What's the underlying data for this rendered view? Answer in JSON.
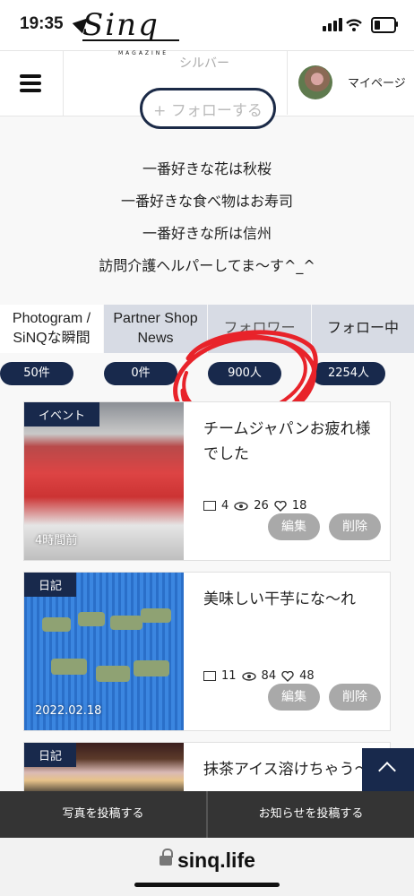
{
  "status_bar": {
    "time": "19:35"
  },
  "header": {
    "logo_text": "Sinq",
    "logo_sub": "MAGAZINE",
    "rank_label": "シルバー",
    "follow_button": "+ フォローする",
    "mypage_label": "マイページ"
  },
  "profile": {
    "bio_lines": [
      "一番好きな花は秋桜",
      "一番好きな食べ物はお寿司",
      "一番好きな所は信州",
      "訪問介護ヘルパーしてま〜す^_^"
    ]
  },
  "tabs": [
    {
      "label": "Photogram / SiNQな瞬間",
      "count": "50件",
      "active": true
    },
    {
      "label": "Partner Shop News",
      "count": "0件",
      "active": false
    },
    {
      "label": "フォロワー",
      "count": "900人",
      "active": false
    },
    {
      "label": "フォロー中",
      "count": "2254人",
      "active": false
    }
  ],
  "posts": [
    {
      "tag": "イベント",
      "date": "4時間前",
      "title": "チームジャパンお疲れ様でした",
      "comments": "4",
      "views": "26",
      "likes": "18",
      "edit": "編集",
      "delete": "削除"
    },
    {
      "tag": "日記",
      "date": "2022.02.18",
      "title": "美味しい干芋にな〜れ",
      "comments": "11",
      "views": "84",
      "likes": "48",
      "edit": "編集",
      "delete": "削除"
    },
    {
      "tag": "日記",
      "date": "",
      "title": "抹茶アイス溶けちゃう〜",
      "comments": "",
      "views": "",
      "likes": "",
      "edit": "",
      "delete": ""
    }
  ],
  "bottom_bar": {
    "post_photo": "写真を投稿する",
    "post_notice": "お知らせを投稿する"
  },
  "url_bar": {
    "domain": "sinq.life"
  },
  "colors": {
    "navy": "#18294c",
    "annotation": "#e8232a",
    "tab_bg": "#d7dbe4"
  }
}
